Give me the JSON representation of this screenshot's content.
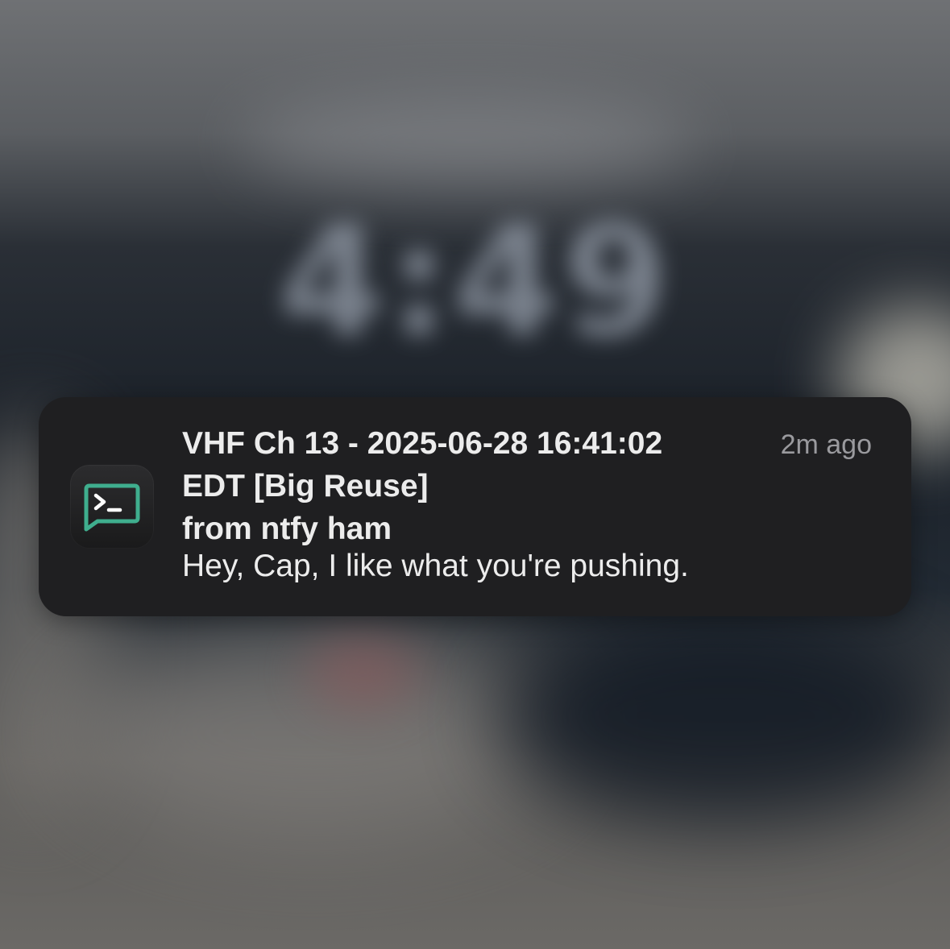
{
  "lock_screen": {
    "clock_text": "4:49"
  },
  "notification": {
    "app_icon": "terminal-chat-icon",
    "accent_color": "#3fae8e",
    "title": "VHF Ch 13 - 2025-06-28 16:41:02\nEDT [Big Reuse]\nfrom ntfy ham",
    "body": "Hey, Cap, I like what you're pushing.",
    "time": "2m ago"
  }
}
